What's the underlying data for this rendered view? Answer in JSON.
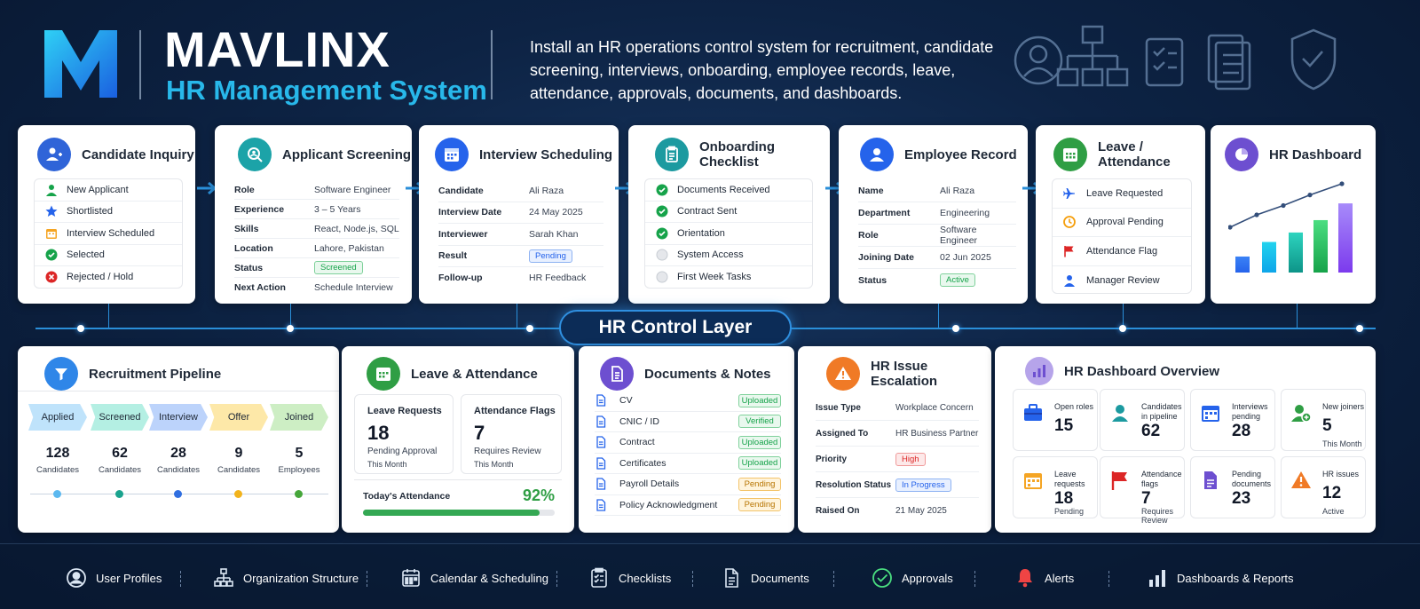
{
  "brand": {
    "name": "MAVLINX",
    "subtitle": "HR Management System",
    "tagline": "Install an HR operations control system for recruitment, candidate screening, interviews, onboarding, employee records, leave, attendance, approvals, documents, and dashboards."
  },
  "colors": {
    "navy": "#0d2344",
    "accent": "#28b8ea",
    "green": "#16a34a",
    "blue": "#2563eb",
    "amber": "#f59e0b",
    "red": "#dc2626",
    "purple": "#6d4fd0"
  },
  "candidate_inquiry": {
    "title": "Candidate Inquiry",
    "icon": "add-user-icon",
    "items": [
      {
        "label": "New Applicant",
        "icon": "person-icon"
      },
      {
        "label": "Shortlisted",
        "icon": "star-icon"
      },
      {
        "label": "Interview Scheduled",
        "icon": "calendar-icon"
      },
      {
        "label": "Selected",
        "icon": "check-circle-icon"
      },
      {
        "label": "Rejected / Hold",
        "icon": "x-circle-icon"
      }
    ]
  },
  "applicant_screening": {
    "title": "Applicant Screening",
    "icon": "search-user-icon",
    "rows": [
      {
        "k": "Role",
        "v": "Software Engineer"
      },
      {
        "k": "Experience",
        "v": "3 – 5 Years"
      },
      {
        "k": "Skills",
        "v": "React, Node.js, SQL"
      },
      {
        "k": "Location",
        "v": "Lahore, Pakistan"
      },
      {
        "k": "Status",
        "v": "Screened"
      },
      {
        "k": "Next Action",
        "v": "Schedule Interview"
      }
    ]
  },
  "interview_scheduling": {
    "title": "Interview Scheduling",
    "icon": "calendar-icon",
    "rows": [
      {
        "k": "Candidate",
        "v": "Ali Raza"
      },
      {
        "k": "Interview Date",
        "v": "24 May 2025"
      },
      {
        "k": "Interviewer",
        "v": "Sarah Khan"
      },
      {
        "k": "Result",
        "v": "Pending"
      },
      {
        "k": "Follow-up",
        "v": "HR Feedback"
      }
    ]
  },
  "onboarding_checklist": {
    "title": "Onboarding Checklist",
    "icon": "clipboard-icon",
    "items": [
      {
        "label": "Documents Received",
        "done": true
      },
      {
        "label": "Contract Sent",
        "done": true
      },
      {
        "label": "Orientation",
        "done": true
      },
      {
        "label": "System Access",
        "done": false
      },
      {
        "label": "First Week Tasks",
        "done": false
      }
    ]
  },
  "employee_record": {
    "title": "Employee Record",
    "icon": "user-icon",
    "rows": [
      {
        "k": "Name",
        "v": "Ali Raza"
      },
      {
        "k": "Department",
        "v": "Engineering"
      },
      {
        "k": "Role",
        "v": "Software Engineer"
      },
      {
        "k": "Joining Date",
        "v": "02 Jun 2025"
      },
      {
        "k": "Status",
        "v": "Active"
      }
    ]
  },
  "leave_attendance_top": {
    "title": "Leave / Attendance",
    "icon": "calendar-icon",
    "items": [
      {
        "label": "Leave Requested",
        "icon": "plane-icon"
      },
      {
        "label": "Approval Pending",
        "icon": "clock-icon"
      },
      {
        "label": "Attendance Flag",
        "icon": "flag-icon"
      },
      {
        "label": "Manager Review",
        "icon": "person-icon"
      }
    ]
  },
  "hr_dashboard": {
    "title": "HR Dashboard",
    "icon": "pie-chart-icon",
    "bars": [
      0.22,
      0.42,
      0.55,
      0.72,
      0.95
    ],
    "trend": [
      0.3,
      0.5,
      0.65,
      0.82,
      1.0
    ]
  },
  "control_layer": {
    "label": "HR Control Layer"
  },
  "recruitment_pipeline": {
    "title": "Recruitment Pipeline",
    "icon": "funnel-icon",
    "stages": [
      {
        "name": "Applied",
        "count": "128",
        "unit": "Candidates",
        "color": "#bfe3fb",
        "dot": "#5bb8ef"
      },
      {
        "name": "Screened",
        "count": "62",
        "unit": "Candidates",
        "color": "#b4efe3",
        "dot": "#1aa38e"
      },
      {
        "name": "Interview",
        "count": "28",
        "unit": "Candidates",
        "color": "#bcd3fb",
        "dot": "#2f6ee0"
      },
      {
        "name": "Offer",
        "count": "9",
        "unit": "Candidates",
        "color": "#fde8a8",
        "dot": "#f2b31c"
      },
      {
        "name": "Joined",
        "count": "5",
        "unit": "Employees",
        "color": "#cdeec4",
        "dot": "#45a63a"
      }
    ]
  },
  "leave_attendance": {
    "title": "Leave & Attendance",
    "icon": "calendar-icon",
    "leave_requests": {
      "label": "Leave Requests",
      "value": "18",
      "sub": "Pending Approval",
      "period": "This Month"
    },
    "attendance_flags": {
      "label": "Attendance Flags",
      "value": "7",
      "sub": "Requires Review",
      "period": "This Month"
    },
    "today": {
      "label": "Today's Attendance",
      "value": "92%",
      "fraction": 0.92
    }
  },
  "documents_notes": {
    "title": "Documents & Notes",
    "icon": "document-icon",
    "items": [
      {
        "label": "CV",
        "status": "Uploaded",
        "tone": "green"
      },
      {
        "label": "CNIC / ID",
        "status": "Verified",
        "tone": "green"
      },
      {
        "label": "Contract",
        "status": "Uploaded",
        "tone": "green"
      },
      {
        "label": "Certificates",
        "status": "Uploaded",
        "tone": "green"
      },
      {
        "label": "Payroll Details",
        "status": "Pending",
        "tone": "amber"
      },
      {
        "label": "Policy Acknowledgment",
        "status": "Pending",
        "tone": "amber"
      }
    ]
  },
  "hr_issue": {
    "title": "HR Issue Escalation",
    "icon": "warning-icon",
    "rows": [
      {
        "k": "Issue Type",
        "v": "Workplace Concern"
      },
      {
        "k": "Assigned To",
        "v": "HR Business Partner"
      },
      {
        "k": "Priority",
        "v": "High"
      },
      {
        "k": "Resolution Status",
        "v": "In Progress"
      },
      {
        "k": "Raised On",
        "v": "21 May 2025"
      }
    ]
  },
  "overview": {
    "title": "HR Dashboard Overview",
    "icon": "bar-chart-icon",
    "tiles": [
      {
        "label": "Open roles",
        "value": "15",
        "sub": "",
        "icon": "briefcase-icon"
      },
      {
        "label": "Candidates in pipeline",
        "value": "62",
        "sub": "",
        "icon": "person-icon"
      },
      {
        "label": "Interviews pending",
        "value": "28",
        "sub": "",
        "icon": "calendar-icon"
      },
      {
        "label": "New joiners",
        "value": "5",
        "sub": "This Month",
        "icon": "add-user-icon"
      },
      {
        "label": "Leave requests",
        "value": "18",
        "sub": "Pending",
        "icon": "calendar-icon"
      },
      {
        "label": "Attendance flags",
        "value": "7",
        "sub": "Requires Review",
        "icon": "flag-icon"
      },
      {
        "label": "Pending documents",
        "value": "23",
        "sub": "",
        "icon": "document-icon"
      },
      {
        "label": "HR issues",
        "value": "12",
        "sub": "Active",
        "icon": "warning-icon"
      }
    ]
  },
  "footer": {
    "items": [
      {
        "label": "User Profiles",
        "icon": "user-profile-icon"
      },
      {
        "label": "Organization Structure",
        "icon": "org-chart-icon"
      },
      {
        "label": "Calendar & Scheduling",
        "icon": "calendar-icon"
      },
      {
        "label": "Checklists",
        "icon": "checklist-icon"
      },
      {
        "label": "Documents",
        "icon": "document-icon"
      },
      {
        "label": "Approvals",
        "icon": "check-circle-icon"
      },
      {
        "label": "Alerts",
        "icon": "bell-icon"
      },
      {
        "label": "Dashboards & Reports",
        "icon": "bar-chart-icon"
      }
    ]
  }
}
